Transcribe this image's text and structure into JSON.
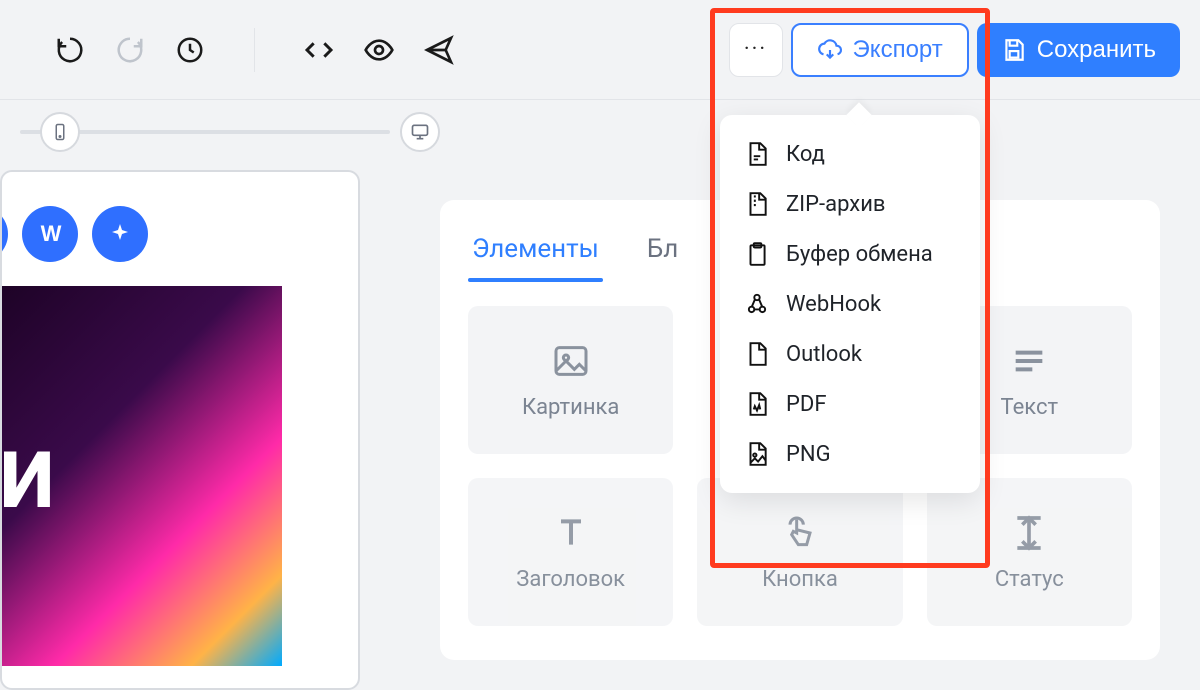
{
  "toolbar": {
    "export_label": "Экспорт",
    "save_label": "Сохранить"
  },
  "tabs": {
    "elements": "Элементы",
    "blocks_partial": "Бл"
  },
  "elements": {
    "image": "Картинка",
    "text": "Текст",
    "heading_partial": "Заголовок",
    "button_partial": "Кнопка",
    "status_partial": "Статус"
  },
  "export_menu": {
    "items": [
      {
        "id": "code",
        "label": "Код"
      },
      {
        "id": "zip",
        "label": "ZIP-архив"
      },
      {
        "id": "clipboard",
        "label": "Буфер обмена"
      },
      {
        "id": "webhook",
        "label": "WebHook"
      },
      {
        "id": "outlook",
        "label": "Outlook"
      },
      {
        "id": "pdf",
        "label": "PDF"
      },
      {
        "id": "png",
        "label": "PNG"
      }
    ]
  }
}
